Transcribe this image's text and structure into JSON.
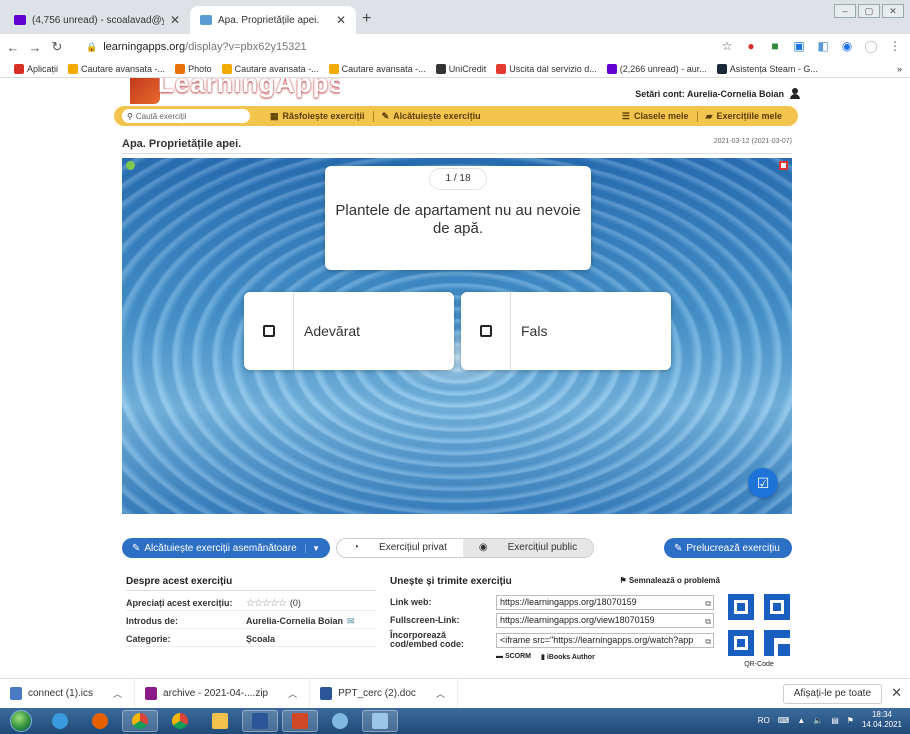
{
  "browser": {
    "tabs": [
      {
        "title": "(4,756 unread) - scoalavad@yaho",
        "color": "#6001d2"
      },
      {
        "title": "Apa. Proprietățile apei.",
        "color": "#5b9bd5"
      }
    ],
    "new_tab": "+",
    "url_host": "learningapps.org",
    "url_path": "/display?v=pbx62y15321",
    "bookmarks": [
      {
        "label": "Aplicații",
        "color": "#d93025"
      },
      {
        "label": "Cautare avansata -...",
        "color": "#f2a900"
      },
      {
        "label": "Photo",
        "color": "#e8710a"
      },
      {
        "label": "Cautare avansata -...",
        "color": "#f2a900"
      },
      {
        "label": "Cautare avansata -...",
        "color": "#f2a900"
      },
      {
        "label": "UniCredit",
        "color": "#333333"
      },
      {
        "label": "Uscita dal servizio d...",
        "color": "#e33b2e"
      },
      {
        "label": "(2,266 unread) - aur...",
        "color": "#6001d2"
      },
      {
        "label": "Asistența Steam - G...",
        "color": "#1b2838"
      }
    ],
    "bookmarks_more": "»"
  },
  "site": {
    "logo_text": "LearningApps.org",
    "account_label": "Setări cont: Aurelia-Cornelia Boian",
    "search_placeholder": "Caută exerciții",
    "menu_browse": "Răsfoiește exerciții",
    "menu_create": "Alcătuiește exercițiu",
    "menu_classes": "Clasele mele",
    "menu_mine": "Exercițiile mele",
    "exercise_title": "Apa. Proprietățile apei.",
    "exercise_date": "2021-03-12 (2021-03-07)"
  },
  "exercise": {
    "counter": "1 / 18",
    "question": "Plantele de apartament nu au nevoie de apă.",
    "answers": [
      "Adevărat",
      "Fals"
    ]
  },
  "actions": {
    "similar": "Alcătuiește exerciții asemănătoare",
    "private": "Exercițiul privat",
    "public": "Exercițiul public",
    "edit": "Prelucrează exercițiu"
  },
  "about": {
    "heading": "Despre acest exercițiu",
    "rate_label": "Apreciați acest exercițiu:",
    "rating_count": "(0)",
    "author_label": "Introdus de:",
    "author": "Aurelia-Cornelia Boian",
    "category_label": "Categorie:",
    "category": "Școala"
  },
  "share": {
    "heading": "Unește și trimite exercițiu",
    "report": "Semnalează o problemă",
    "link_label": "Link web:",
    "link_value": "https://learningapps.org/18070159",
    "fullscreen_label": "Fullscreen-Link:",
    "fullscreen_value": "https://learningapps.org/view18070159",
    "embed_label": "Încorporează cod/embed code:",
    "embed_value": "<iframe src=\"https://learningapps.org/watch?app",
    "scorm": "SCORM",
    "ibooks": "iBooks Author",
    "qr_label": "QR-Code"
  },
  "downloads": {
    "items": [
      {
        "name": "connect (1).ics",
        "color": "#4a78c2"
      },
      {
        "name": "archive - 2021-04-....zip",
        "color": "#8b1a8b"
      },
      {
        "name": "PPT_cerc (2).doc",
        "color": "#2b579a"
      }
    ],
    "show_all": "Afișați-le pe toate",
    "close": "✕"
  },
  "taskbar": {
    "lang": "RO",
    "time": "18:34",
    "date": "14.04.2021"
  }
}
